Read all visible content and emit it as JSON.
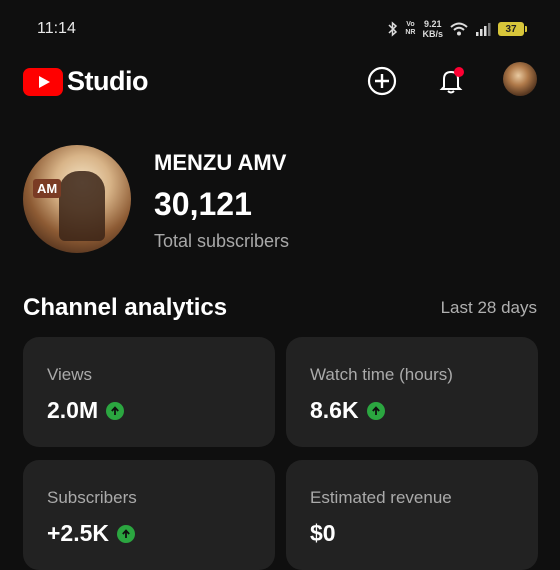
{
  "status_bar": {
    "time": "11:14",
    "volte": "Vo\nNR",
    "net_speed": "9.21\nKB/s",
    "battery": "37"
  },
  "header": {
    "app_name": "Studio",
    "icons": [
      "youtube-logo-icon",
      "add-circle-icon",
      "bell-icon",
      "avatar"
    ]
  },
  "channel": {
    "name": "MENZU AMV",
    "subscribers": "30,121",
    "subscribers_label": "Total subscribers",
    "avatar_text": "AM"
  },
  "analytics": {
    "title": "Channel analytics",
    "period": "Last 28 days",
    "cards": [
      {
        "label": "Views",
        "value": "2.0M",
        "trend": "up"
      },
      {
        "label": "Watch time (hours)",
        "value": "8.6K",
        "trend": "up"
      },
      {
        "label": "Subscribers",
        "value": "+2.5K",
        "trend": "up"
      },
      {
        "label": "Estimated revenue",
        "value": "$0",
        "trend": "none"
      }
    ]
  },
  "colors": {
    "background": "#0f0f0f",
    "card": "#222222",
    "brand_red": "#ff0000",
    "trend_up": "#2ba640"
  }
}
